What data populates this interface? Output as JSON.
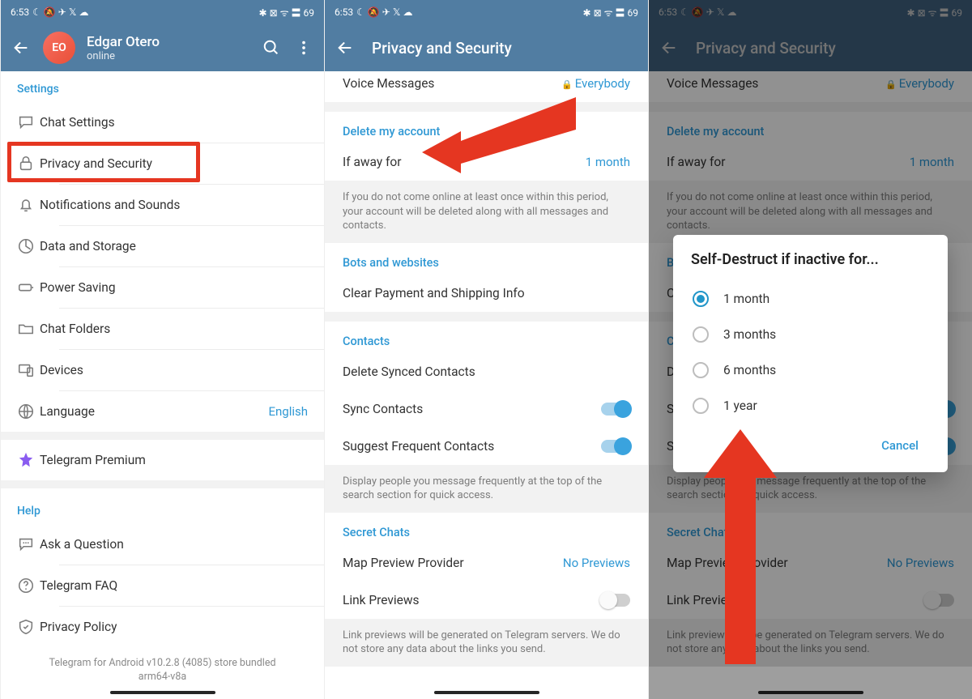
{
  "status": {
    "time": "6:53",
    "rightIcons": "✱ ⊠ ᯤ 〓 69",
    "leftIcons": "☾ 🔕 ✈ 𝕏 ☁"
  },
  "d1": {
    "profile": {
      "initials": "EO",
      "name": "Edgar Otero",
      "status": "online"
    },
    "sectionSettings": "Settings",
    "items": {
      "chatSettings": "Chat Settings",
      "privacy": "Privacy and Security",
      "notifications": "Notifications and Sounds",
      "data": "Data and Storage",
      "power": "Power Saving",
      "folders": "Chat Folders",
      "devices": "Devices",
      "language": "Language",
      "languageValue": "English",
      "premium": "Telegram Premium"
    },
    "sectionHelp": "Help",
    "help": {
      "ask": "Ask a Question",
      "faq": "Telegram FAQ",
      "privacyPolicy": "Privacy Policy"
    },
    "footnote": "Telegram for Android v10.2.8 (4085) store bundled arm64-v8a"
  },
  "d2": {
    "title": "Privacy and Security",
    "voiceMessages": "Voice Messages",
    "voiceValue": "Everybody",
    "secDelete": "Delete my account",
    "ifAway": "If away for",
    "ifAwayValue": "1 month",
    "deleteNote": "If you do not come online at least once within this period, your account will be deleted along with all messages and contacts.",
    "secBots": "Bots and websites",
    "clearPayment": "Clear Payment and Shipping Info",
    "secContacts": "Contacts",
    "deleteSynced": "Delete Synced Contacts",
    "syncContacts": "Sync Contacts",
    "suggestFreq": "Suggest Frequent Contacts",
    "freqNote": "Display people you message frequently at the top of the search section for quick access.",
    "secSecret": "Secret Chats",
    "mapPreview": "Map Preview Provider",
    "mapValue": "No Previews",
    "linkPreviews": "Link Previews",
    "linkNote": "Link previews will be generated on Telegram servers. We do not store any data about the links you send."
  },
  "d3": {
    "dialogTitle": "Self-Destruct if inactive for...",
    "opt1": "1 month",
    "opt3": "3 months",
    "opt6": "6 months",
    "opt12": "1 year",
    "cancel": "Cancel"
  }
}
